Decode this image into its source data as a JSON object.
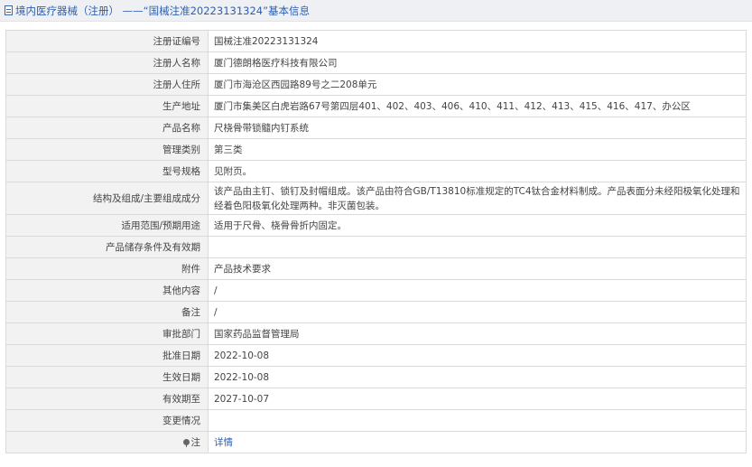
{
  "header": {
    "title": "境内医疗器械（注册） ——“国械注准20223131324”基本信息"
  },
  "rows": [
    {
      "label": "注册证编号",
      "value": "国械注准20223131324"
    },
    {
      "label": "注册人名称",
      "value": "厦门德朗格医疗科技有限公司"
    },
    {
      "label": "注册人住所",
      "value": "厦门市海沧区西园路89号之二208单元"
    },
    {
      "label": "生产地址",
      "value": "厦门市集美区白虎岩路67号第四层401、402、403、406、410、411、412、413、415、416、417、办公区"
    },
    {
      "label": "产品名称",
      "value": "尺桡骨带锁髓内钉系统"
    },
    {
      "label": "管理类别",
      "value": "第三类"
    },
    {
      "label": "型号规格",
      "value": "见附页。"
    },
    {
      "label": "结构及组成/主要组成成分",
      "value": "该产品由主钉、锁钉及封帽组成。该产品由符合GB/T13810标准规定的TC4钛合金材料制成。产品表面分未经阳极氧化处理和经着色阳极氧化处理两种。非灭菌包装。"
    },
    {
      "label": "适用范围/预期用途",
      "value": "适用于尺骨、桡骨骨折内固定。"
    },
    {
      "label": "产品储存条件及有效期",
      "value": ""
    },
    {
      "label": "附件",
      "value": "产品技术要求"
    },
    {
      "label": "其他内容",
      "value": "/"
    },
    {
      "label": "备注",
      "value": "/"
    },
    {
      "label": "审批部门",
      "value": "国家药品监督管理局"
    },
    {
      "label": "批准日期",
      "value": "2022-10-08"
    },
    {
      "label": "生效日期",
      "value": "2022-10-08"
    },
    {
      "label": "有效期至",
      "value": "2027-10-07"
    },
    {
      "label": "变更情况",
      "value": ""
    },
    {
      "label": "注",
      "value": "详情"
    }
  ]
}
